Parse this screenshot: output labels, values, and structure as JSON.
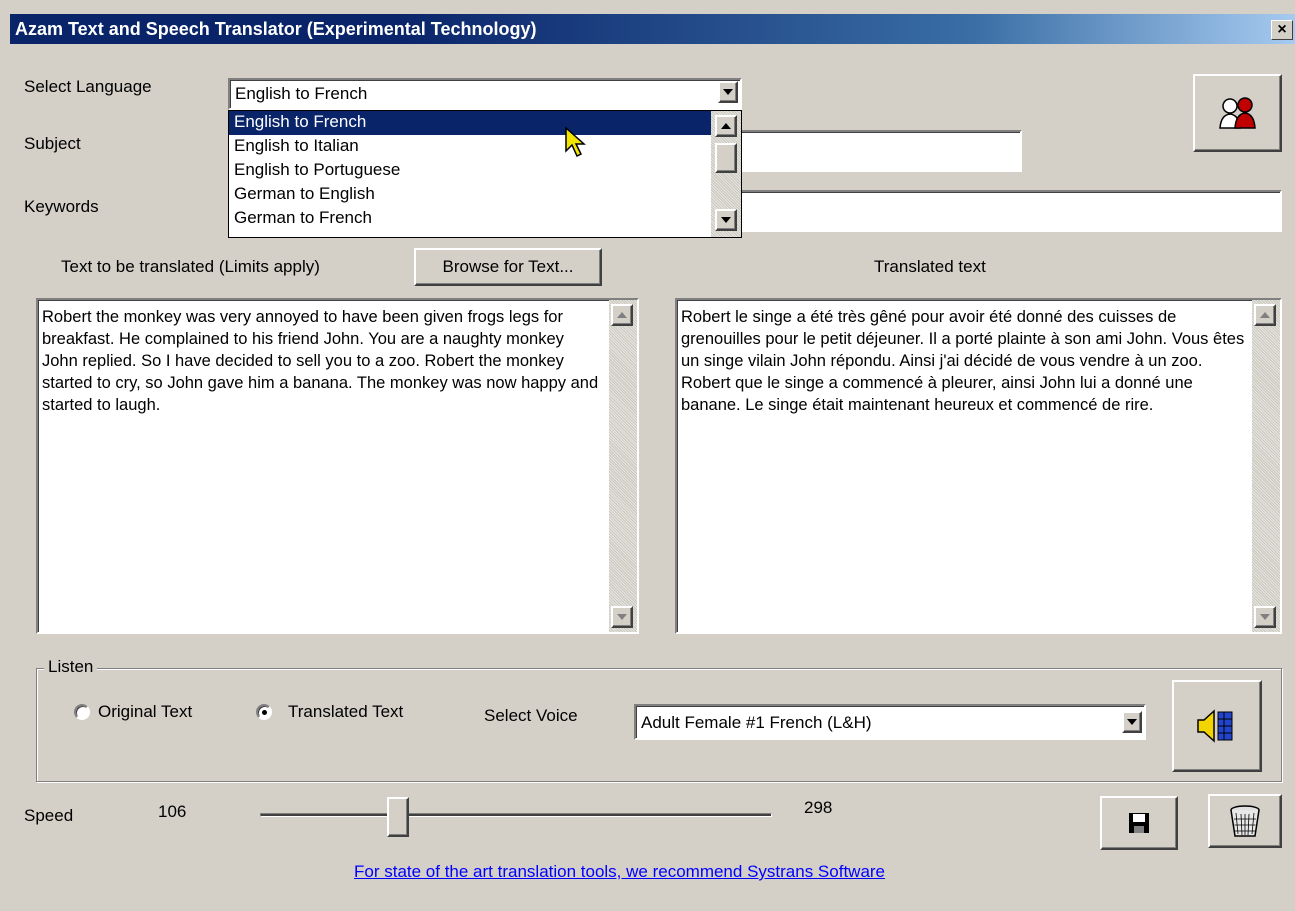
{
  "window": {
    "title": "Azam Text and Speech Translator (Experimental Technology)",
    "close_label": "×"
  },
  "labels": {
    "select_language": "Select Language",
    "subject": "Subject",
    "keywords": "Keywords",
    "text_to_translate": "Text to be translated (Limits apply)",
    "translated_text": "Translated text",
    "select_voice": "Select Voice",
    "speed": "Speed"
  },
  "language_select": {
    "value": "English to French",
    "options": [
      "English to French",
      "English to Italian",
      "English to Portuguese",
      "German to English",
      "German to French"
    ],
    "highlighted_index": 0
  },
  "subject_value": "",
  "keywords_value": "",
  "browse_button": "Browse for Text...",
  "original_text": "Robert the monkey was very annoyed to have been given frogs legs for breakfast. He complained to his friend John. You are a naughty monkey John replied. So I have decided to sell you to a zoo. Robert the monkey started to cry, so John gave him a banana. The monkey was now happy and started to laugh.",
  "translated_text": "Robert le singe a été très gêné pour avoir été donné des cuisses de grenouilles pour le petit déjeuner.  Il a porté plainte à son ami John.  Vous êtes un singe vilain John répondu.  Ainsi j'ai décidé de vous vendre à un zoo.  Robert que le singe a commencé à pleurer, ainsi John lui a donné une banane.  Le singe était maintenant heureux et commencé de rire.",
  "listen": {
    "legend": "Listen",
    "options": [
      "Original Text",
      "Translated Text"
    ],
    "selected": "Translated Text"
  },
  "voice_select": {
    "value": "Adult Female #1 French (L&H)"
  },
  "speed": {
    "min_label": "106",
    "max_label": "298",
    "value_fraction": 0.27
  },
  "footer_link": "For state of the art translation tools, we recommend Systrans Software",
  "icons": {
    "people": "people-icon",
    "speaker": "speaker-icon",
    "save": "floppy-disk-icon",
    "clear": "wastebasket-icon",
    "cursor": "mouse-pointer-icon"
  },
  "colors": {
    "title_start": "#0a246a",
    "title_end": "#a6caf0",
    "selection": "#0a246a",
    "face": "#d4d0c8",
    "link": "#0000ff"
  }
}
